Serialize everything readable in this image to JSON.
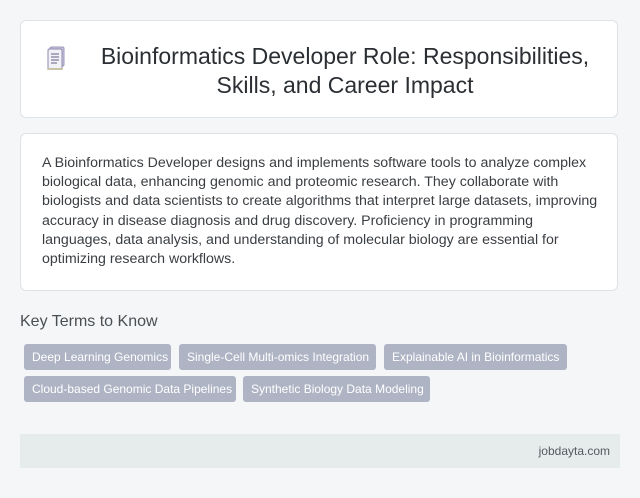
{
  "header": {
    "title": "Bioinformatics Developer Role: Responsibilities, Skills, and Career Impact",
    "icon": "document-icon"
  },
  "description": "A Bioinformatics Developer designs and implements software tools to analyze complex biological data, enhancing genomic and proteomic research. They collaborate with biologists and data scientists to create algorithms that interpret large datasets, improving accuracy in disease diagnosis and drug discovery. Proficiency in programming languages, data analysis, and understanding of molecular biology are essential for optimizing research workflows.",
  "key_terms": {
    "heading": "Key Terms to Know",
    "tags": [
      "Deep Learning Genomics",
      "Single-Cell Multi-omics Integration",
      "Explainable AI in Bioinformatics",
      "Cloud-based Genomic Data Pipelines",
      "Synthetic Biology Data Modeling"
    ]
  },
  "footer": {
    "site": "jobdayta.com"
  },
  "colors": {
    "tag_background": "#aeb4c4",
    "footer_background": "#e6ecec",
    "card_background": "#ffffff",
    "page_background": "#f5f6f7"
  }
}
